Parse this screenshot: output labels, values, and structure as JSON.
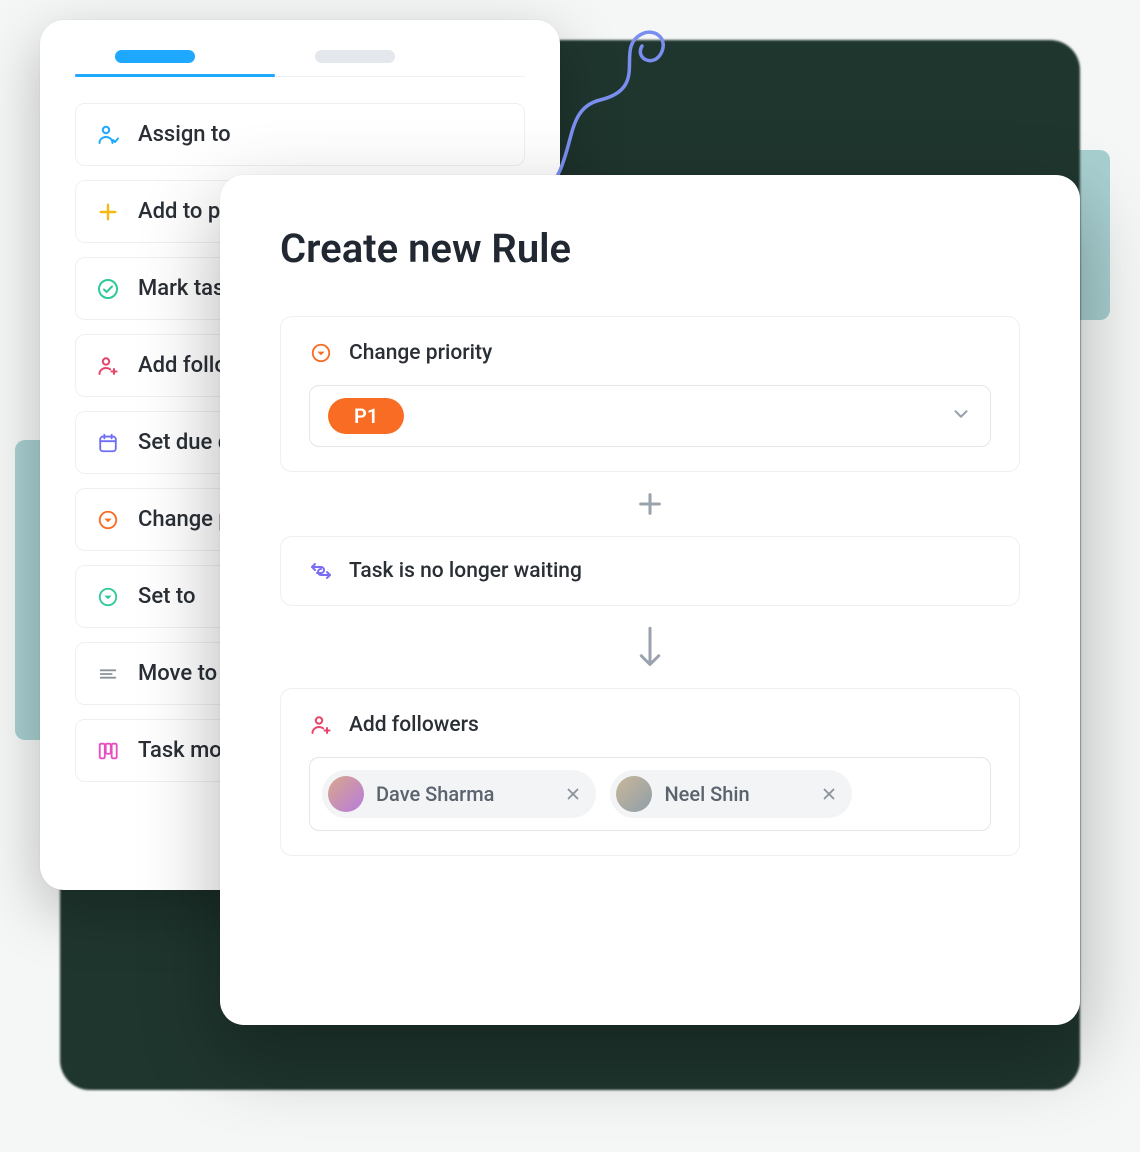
{
  "actions": {
    "assign_to": "Assign to",
    "add_to_project": "Add to project",
    "mark_task": "Mark task",
    "add_followers": "Add followers",
    "set_due": "Set due date",
    "change_priority": "Change priority",
    "set_to": "Set to",
    "move_to": "Move to",
    "task_move": "Task move"
  },
  "modal": {
    "title": "Create new Rule",
    "change_priority_label": "Change priority",
    "priority_value": "P1",
    "waiting_label": "Task is no longer waiting",
    "add_followers_label": "Add followers",
    "followers": [
      {
        "name": "Dave Sharma"
      },
      {
        "name": "Neel Shin"
      }
    ]
  }
}
